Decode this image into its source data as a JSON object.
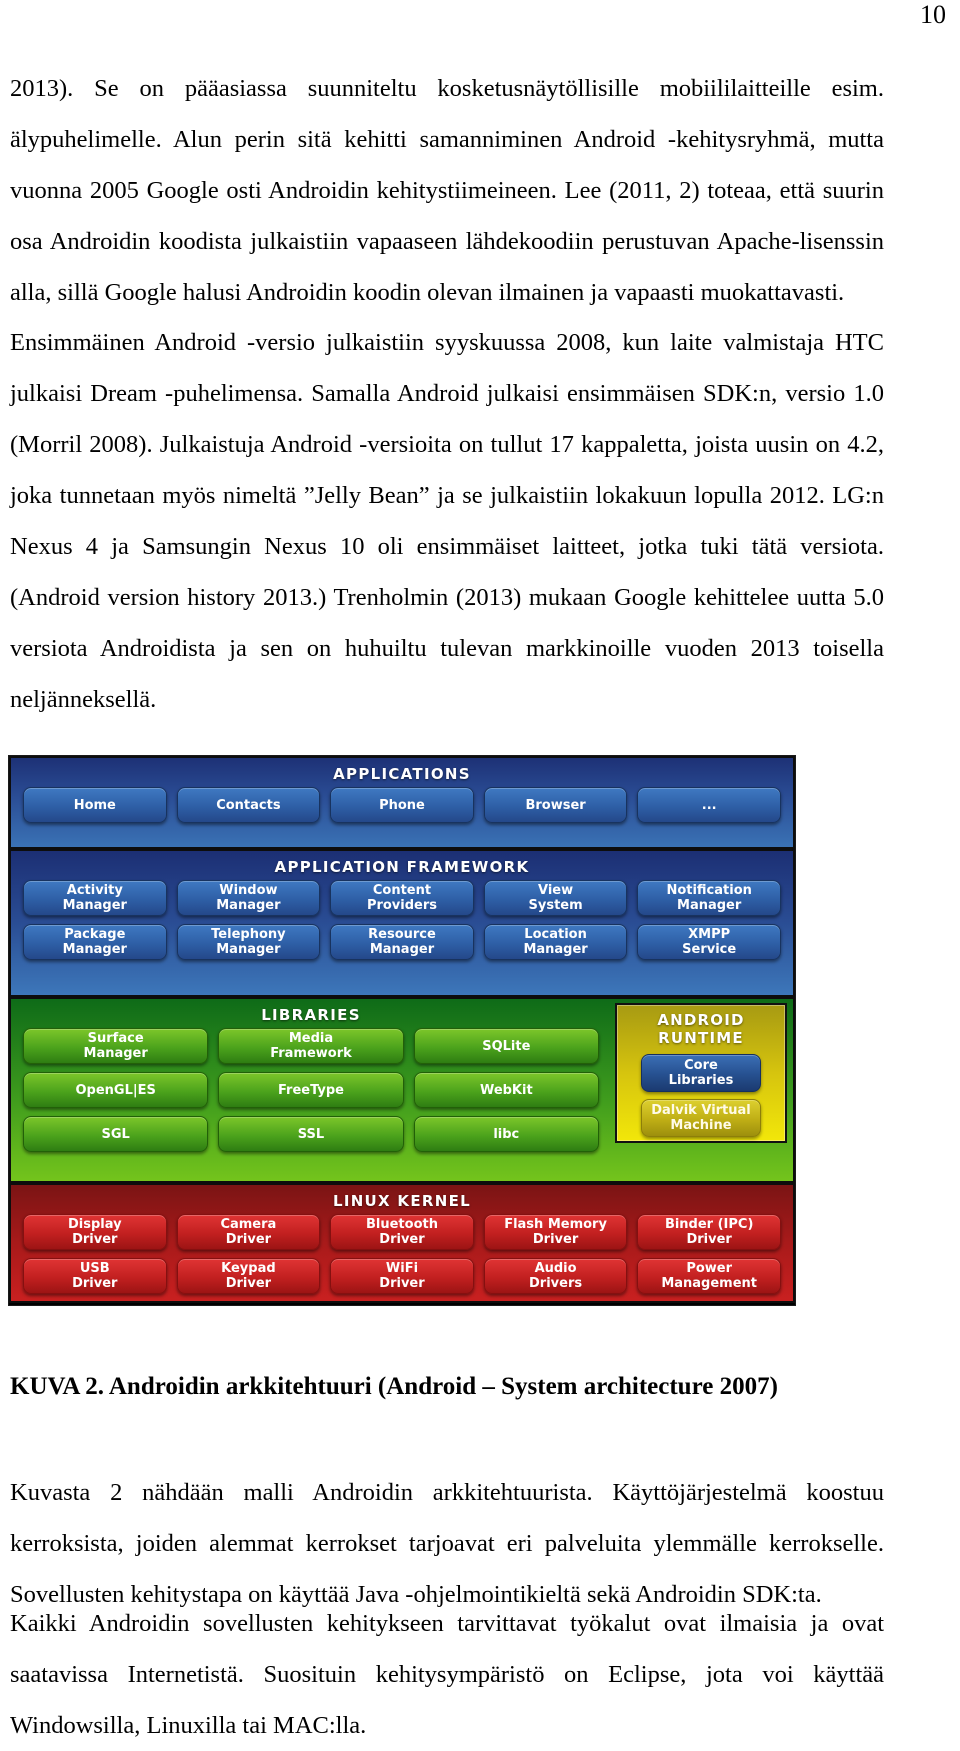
{
  "page": {
    "number": "10"
  },
  "paragraphs": {
    "p1": "2013). Se on pääasiassa suunniteltu kosketusnäytöllisille mobiililaitteille esim. älypuhelimelle. Alun perin sitä kehitti samanniminen Android -kehitysryhmä, mutta vuonna 2005 Google osti Androidin kehitystiimeineen. Lee (2011, 2) toteaa, että suurin osa Androidin koodista julkaistiin vapaaseen lähdekoodiin perustuvan Apache-lisenssin alla, sillä Google halusi Androidin koodin olevan ilmainen ja vapaasti muokattavasti.",
    "p2": "Ensimmäinen Android -versio julkaistiin syyskuussa 2008, kun laite valmistaja HTC julkaisi Dream -puhelimensa. Samalla Android julkaisi ensimmäisen SDK:n, versio 1.0 (Morril 2008). Julkaistuja Android -versioita on tullut 17 kappaletta, joista uusin on 4.2, joka tunnetaan myös nimeltä ”Jelly Bean” ja se julkaistiin lokakuun lopulla 2012. LG:n Nexus 4 ja Samsungin Nexus 10 oli ensimmäiset laitteet, jotka tuki tätä versiota. (Android version history 2013.)  Trenholmin (2013) mukaan Google kehittelee uutta 5.0 versiota Androidista ja sen on huhuiltu tulevan markkinoille vuoden 2013 toisella neljänneksellä.",
    "p3": "Kuvasta 2 nähdään malli Androidin arkkitehtuurista. Käyttöjärjestelmä koostuu kerroksista, joiden alemmat kerrokset tarjoavat eri palveluita ylemmälle kerrokselle. Sovellusten kehitystapa on käyttää Java -ohjelmointikieltä sekä Androidin SDK:ta.",
    "p4": "Kaikki Androidin sovellusten kehitykseen tarvittavat työkalut ovat ilmaisia ja ovat saatavissa Internetistä. Suosituin kehitysympäristö on Eclipse, jota voi käyttää Windowsilla, Linuxilla tai MAC:lla."
  },
  "figure": {
    "caption": "KUVA 2. Androidin arkkitehtuuri (Android – System architecture 2007)",
    "layers": {
      "applications": {
        "title": "Applications",
        "items": [
          "Home",
          "Contacts",
          "Phone",
          "Browser",
          "..."
        ]
      },
      "application_framework": {
        "title": "Application Framework",
        "row1": [
          "Activity\nManager",
          "Window\nManager",
          "Content\nProviders",
          "View\nSystem",
          "Notification\nManager"
        ],
        "row2": [
          "Package\nManager",
          "Telephony\nManager",
          "Resource\nManager",
          "Location\nManager",
          "XMPP\nService"
        ]
      },
      "libraries": {
        "title": "Libraries",
        "row1": [
          "Surface\nManager",
          "Media\nFramework",
          "SQLite"
        ],
        "row2": [
          "OpenGL|ES",
          "FreeType",
          "WebKit"
        ],
        "row3": [
          "SGL",
          "SSL",
          "libc"
        ]
      },
      "android_runtime": {
        "title": "Android Runtime",
        "items": [
          "Core\nLibraries",
          "Dalvik Virtual\nMachine"
        ]
      },
      "linux_kernel": {
        "title": "Linux Kernel",
        "row1": [
          "Display\nDriver",
          "Camera\nDriver",
          "Bluetooth\nDriver",
          "Flash Memory\nDriver",
          "Binder (IPC)\nDriver"
        ],
        "row2": [
          "USB\nDriver",
          "Keypad\nDriver",
          "WiFi\nDriver",
          "Audio\nDrivers",
          "Power\nManagement"
        ]
      }
    },
    "colors": {
      "applications": "#2b4e96",
      "framework": "#2a4d94",
      "libraries": "#3f9c1d",
      "runtime": "#d6c40e",
      "kernel": "#a81a1a"
    }
  }
}
